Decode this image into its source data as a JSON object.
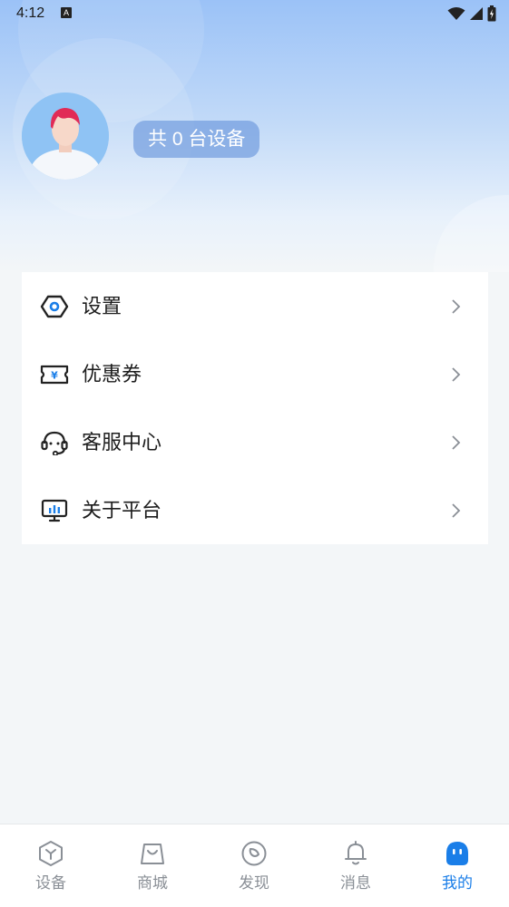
{
  "status_bar": {
    "time": "4:12",
    "notification_icon": "A"
  },
  "profile": {
    "device_count_text": "共 0 台设备"
  },
  "menu": {
    "items": [
      {
        "label": "设置",
        "icon": "settings-hex-icon"
      },
      {
        "label": "优惠券",
        "icon": "coupon-icon"
      },
      {
        "label": "客服中心",
        "icon": "headset-icon"
      },
      {
        "label": "关于平台",
        "icon": "monitor-chart-icon"
      }
    ]
  },
  "tab_bar": {
    "tabs": [
      {
        "label": "设备",
        "icon": "device-cube-icon",
        "active": false
      },
      {
        "label": "商城",
        "icon": "shopping-bag-icon",
        "active": false
      },
      {
        "label": "发现",
        "icon": "discover-compass-icon",
        "active": false
      },
      {
        "label": "消息",
        "icon": "bell-icon",
        "active": false
      },
      {
        "label": "我的",
        "icon": "mascot-face-icon",
        "active": true
      }
    ]
  },
  "colors": {
    "accent": "#1a7ee8",
    "header_top": "#9bc2f7",
    "background": "#f3f6f8"
  }
}
